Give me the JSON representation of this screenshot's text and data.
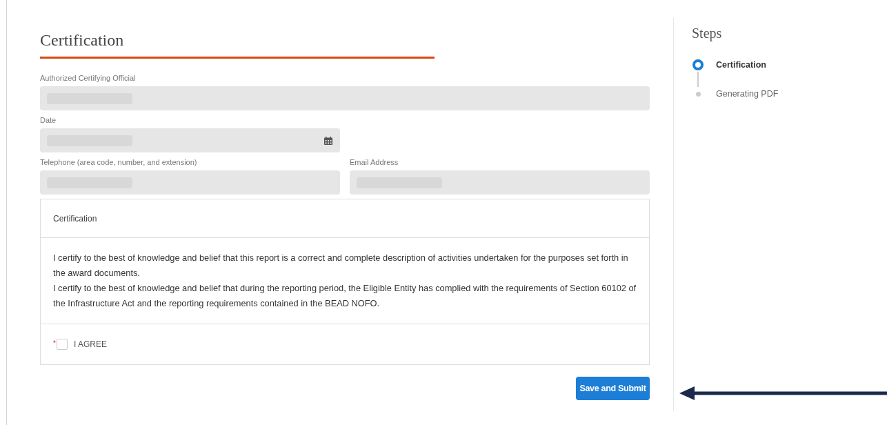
{
  "form": {
    "title": "Certification",
    "field_rows": [
      [
        {
          "label": "Authorized Certifying Official",
          "kind": "text",
          "redacted": true
        }
      ],
      [
        {
          "label": "Date",
          "kind": "date",
          "redacted": true
        }
      ],
      [
        {
          "label": "Telephone (area code, number, and extension)",
          "kind": "text",
          "redacted": true
        },
        {
          "label": "Email Address",
          "kind": "text",
          "redacted": true
        }
      ]
    ],
    "card": {
      "heading": "Certification",
      "paragraphs": [
        "I certify to the best of knowledge and belief that this report is a correct and complete description of activities undertaken for the purposes set forth in the award documents.",
        "I certify to the best of knowledge and belief that during the reporting period, the Eligible Entity has complied with the requirements of Section 60102 of the Infrastructure Act and the reporting requirements contained in the BEAD NOFO."
      ],
      "agree": {
        "required_mark": "*",
        "label": "I AGREE",
        "checked": false
      }
    },
    "submit_button": "Save and Submit"
  },
  "steps": {
    "title": "Steps",
    "items": [
      {
        "label": "Certification",
        "selected": true
      },
      {
        "label": "Generating PDF",
        "selected": false
      }
    ]
  },
  "annotation": {
    "kind": "arrow"
  }
}
